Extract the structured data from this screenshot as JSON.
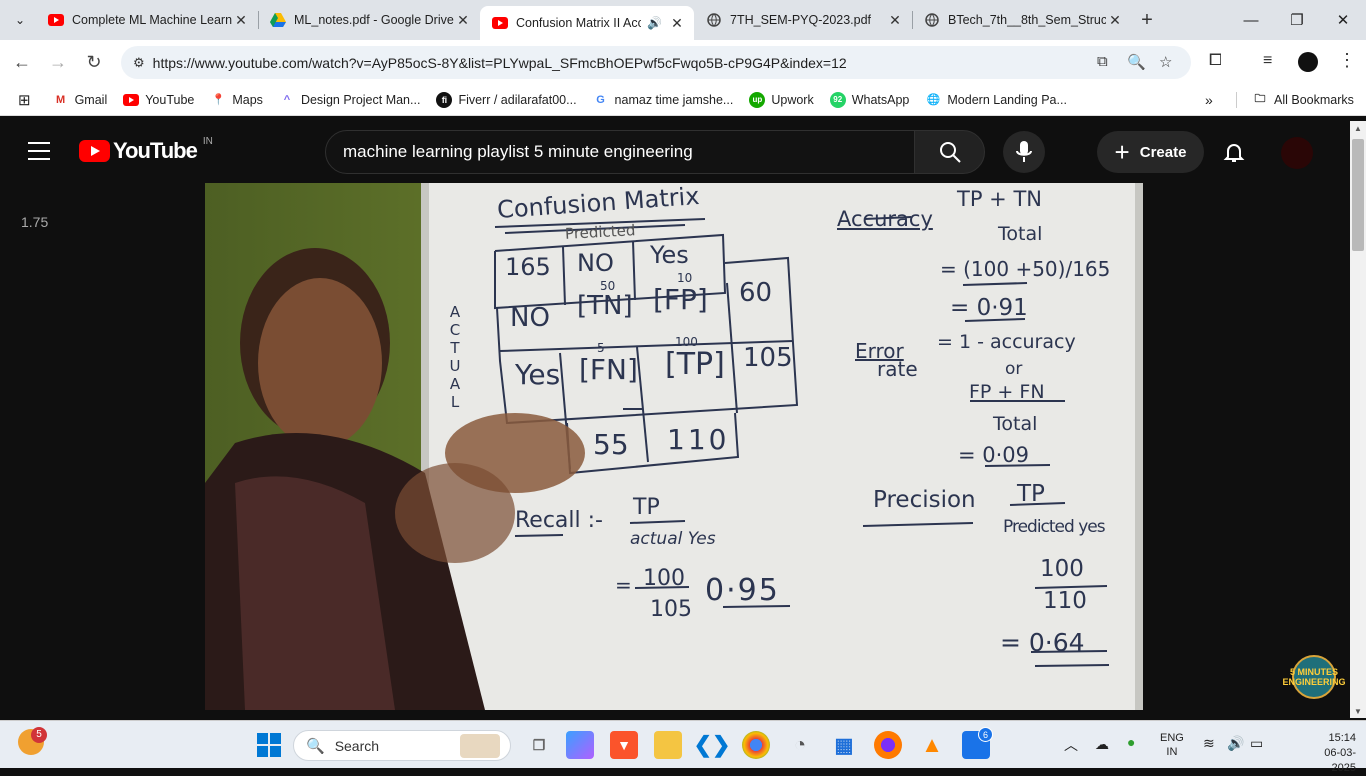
{
  "browser": {
    "tabs": [
      {
        "title": "Complete ML Machine Learn",
        "icon": "youtube-icon",
        "active": false
      },
      {
        "title": "ML_notes.pdf - Google Drive",
        "icon": "google-drive-icon",
        "active": false
      },
      {
        "title": "Confusion Matrix II Accu",
        "icon": "youtube-icon",
        "active": true
      },
      {
        "title": "7TH_SEM-PYQ-2023.pdf",
        "icon": "globe-icon",
        "active": false
      },
      {
        "title": "BTech_7th__8th_Sem_Structu",
        "icon": "globe-icon",
        "active": false
      }
    ],
    "url": "https://www.youtube.com/watch?v=AyP85ocS-8Y&list=PLYwpaL_SFmcBhOEPwf5cFwqo5B-cP9G4P&index=12",
    "bookmarks": [
      "Gmail",
      "YouTube",
      "Maps",
      "Design Project Man...",
      "Fiverr / adilarafat00...",
      "namaz time jamshe...",
      "Upwork",
      "WhatsApp",
      "Modern Landing Pa..."
    ],
    "all_bookmarks_label": "All Bookmarks"
  },
  "youtube": {
    "logo_text": "YouTube",
    "country_code": "IN",
    "search_value": "machine learning playlist 5 minute engineering",
    "create_label": "Create",
    "playback_speed": "1.75"
  },
  "whiteboard": {
    "title": "Confusion Matrix",
    "predicted_label": "Predicted",
    "actual_label": [
      "A",
      "C",
      "T",
      "U",
      "A",
      "L"
    ],
    "matrix": {
      "corner": "165",
      "col_headers": [
        "NO",
        "Yes"
      ],
      "row_headers": [
        "NO",
        "Yes"
      ],
      "cells": [
        [
          "[TN]",
          "[FP]"
        ],
        [
          "[FN]",
          "[TP]"
        ]
      ],
      "cell_values": [
        [
          "50",
          "10"
        ],
        [
          "5",
          "100"
        ]
      ],
      "row_totals": [
        "60",
        "105"
      ],
      "col_totals": [
        "55",
        "110"
      ]
    },
    "accuracy": {
      "label": "Accuracy",
      "num": "TP + TN",
      "den": "Total",
      "step": "= (100 +50)/165",
      "result": "= 0·91"
    },
    "error_rate": {
      "label1": "Error",
      "label2": "rate",
      "eq": "= 1 - accuracy",
      "or": "or",
      "num": "FP + FN",
      "den": "Total",
      "result": "= 0·09"
    },
    "precision": {
      "label": "Precision",
      "num": "TP",
      "den": "Predicted yes",
      "num2": "100",
      "den2": "110",
      "result": "= 0·64"
    },
    "recall": {
      "label": "Recall :-",
      "num": "TP",
      "den": "actual Yes",
      "num2": "100",
      "den2": "105",
      "result": "0·95"
    }
  },
  "channel_badge": "5 MINUTES ENGINEERING",
  "taskbar": {
    "search_placeholder": "Search",
    "weather_badge": "5",
    "vscode_badge": "6",
    "language": "ENG",
    "region": "IN",
    "time": "15:14",
    "date": "06-03-2025"
  }
}
